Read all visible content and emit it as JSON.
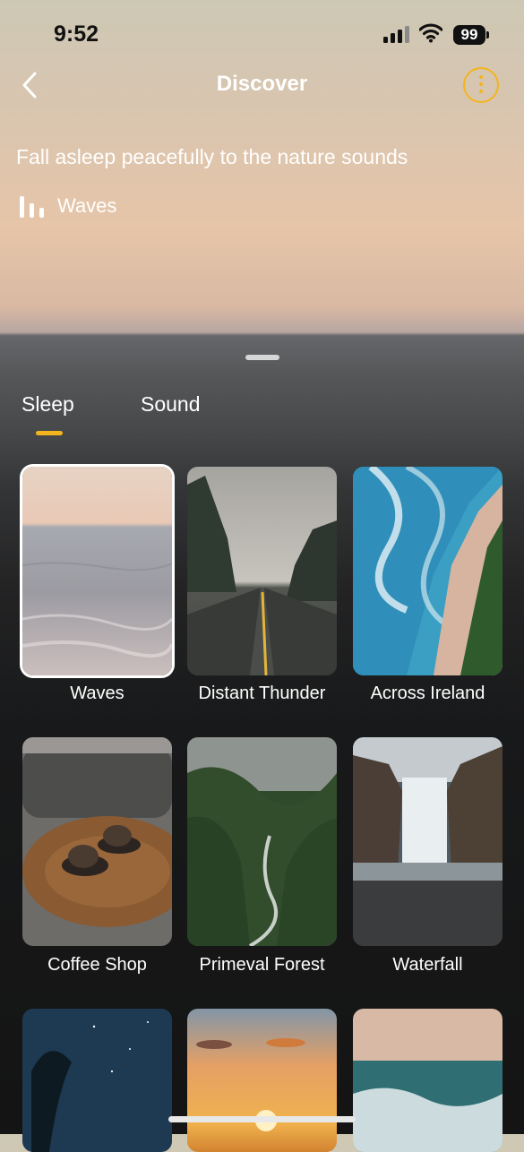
{
  "status_bar": {
    "time": "9:52",
    "battery": "99"
  },
  "header": {
    "title": "Discover"
  },
  "hero": {
    "subtitle": "Fall asleep peacefully to the nature sounds",
    "now_playing": "Waves"
  },
  "tabs": [
    {
      "label": "Sleep",
      "active": true
    },
    {
      "label": "Sound",
      "active": false
    }
  ],
  "sounds": [
    {
      "label": "Waves",
      "selected": true
    },
    {
      "label": "Distant Thunder"
    },
    {
      "label": "Across Ireland"
    },
    {
      "label": "Coffee Shop"
    },
    {
      "label": "Primeval Forest"
    },
    {
      "label": "Waterfall"
    }
  ],
  "colors": {
    "accent": "#f3b51d"
  }
}
